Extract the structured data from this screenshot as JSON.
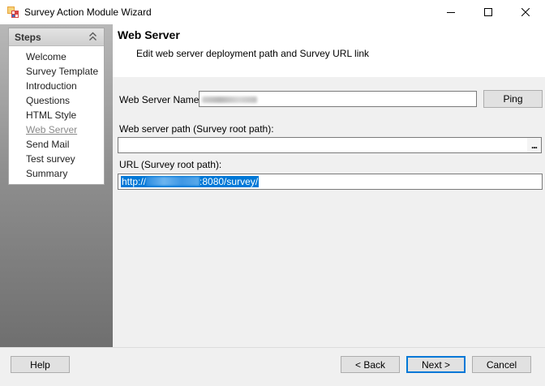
{
  "window": {
    "title": "Survey Action Module Wizard"
  },
  "steps": {
    "header": "Steps",
    "items": [
      {
        "label": "Welcome",
        "current": false
      },
      {
        "label": "Survey Template",
        "current": false
      },
      {
        "label": "Introduction",
        "current": false
      },
      {
        "label": "Questions",
        "current": false
      },
      {
        "label": "HTML Style",
        "current": false
      },
      {
        "label": "Web Server",
        "current": true
      },
      {
        "label": "Send Mail",
        "current": false
      },
      {
        "label": "Test survey",
        "current": false
      },
      {
        "label": "Summary",
        "current": false
      }
    ]
  },
  "page": {
    "title": "Web Server",
    "subtitle": "Edit web server deployment path and Survey URL link"
  },
  "form": {
    "server_name_label": "Web Server Name:",
    "server_name_value": "",
    "ping_label": "Ping",
    "server_path_label": "Web server path (Survey root path):",
    "server_path_value": "",
    "browse_label": "...",
    "url_label": "URL (Survey root path):",
    "url_prefix": "http://",
    "url_suffix": ":8080/survey/"
  },
  "footer": {
    "help_label": "Help",
    "back_label": "< Back",
    "next_label": "Next >",
    "cancel_label": "Cancel"
  },
  "icons": {
    "app": "wizard-app-icon",
    "collapse": "double-chevron-up-icon",
    "minimize": "minimize-icon",
    "maximize": "maximize-icon",
    "close": "close-icon"
  },
  "colors": {
    "selection": "#0078d7",
    "current_step": "#8a8a8a",
    "default_button_border": "#0078d7"
  }
}
